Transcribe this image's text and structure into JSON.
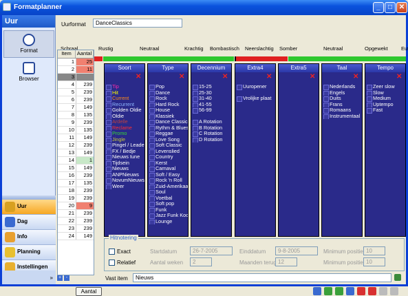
{
  "app": {
    "title": "Formatplanner"
  },
  "left": {
    "header": "Uur",
    "format": "Format",
    "browser": "Browser",
    "nav": [
      "Uur",
      "Dag",
      "Info",
      "Planning",
      "Instellingen"
    ]
  },
  "uurformat": {
    "label": "Uurformat",
    "value": "DanceClassics"
  },
  "scale": [
    "Schraal",
    "Rustig",
    "Neutraal",
    "Krachtig",
    "Bombastisch",
    "Neerslachtig",
    "Somber",
    "Neutraal",
    "Opgewekt",
    "Euforisch"
  ],
  "table": {
    "headers": [
      "Item",
      "Aantal"
    ],
    "rows": [
      [
        "1",
        "25"
      ],
      [
        "2",
        "11"
      ],
      [
        "3",
        ""
      ],
      [
        "4",
        "239"
      ],
      [
        "5",
        "239"
      ],
      [
        "6",
        "239"
      ],
      [
        "7",
        "149"
      ],
      [
        "8",
        "135"
      ],
      [
        "9",
        "239"
      ],
      [
        "10",
        "135"
      ],
      [
        "11",
        "149"
      ],
      [
        "12",
        "239"
      ],
      [
        "13",
        "149"
      ],
      [
        "14",
        "1"
      ],
      [
        "15",
        "149"
      ],
      [
        "16",
        "239"
      ],
      [
        "17",
        "135"
      ],
      [
        "18",
        "239"
      ],
      [
        "19",
        "239"
      ],
      [
        "20",
        "9"
      ],
      [
        "21",
        "239"
      ],
      [
        "22",
        "239"
      ],
      [
        "23",
        "239"
      ],
      [
        "24",
        "149"
      ]
    ],
    "button": "Aantal",
    "plus": "+",
    "minus": "-"
  },
  "panels": [
    {
      "title": "Soort",
      "items": [
        "Tip",
        "Hit",
        "Current",
        "Recurrent",
        "Golden Oldie",
        "Oldie",
        "Ardelle",
        "Reclame",
        "Promo",
        "Jingle",
        "Pingel / Leader",
        "FX / Bedje",
        "Nieuws tune",
        "Tijdsein",
        "Nieuws",
        "ANPNieuws",
        "NovumNieuws",
        "Weer"
      ],
      "colors": [
        "#ff2aa8",
        "#ffff00",
        "#ff8a1a",
        "#8fb7ff",
        "#ffffff",
        "#ffffff",
        "#c04040",
        "#ff3030",
        "#36d836",
        "#c8c83a",
        "#ffffff",
        "#ffffff",
        "#ffffff",
        "#ffffff",
        "#ffffff",
        "#ffffff",
        "#ffffff",
        "#ffffff"
      ]
    },
    {
      "title": "Type",
      "items": [
        "Pop",
        "Dance",
        "Rock",
        "Hard Rock",
        "House",
        "Klassiek",
        "Dance Classic",
        "Rythm & Blues",
        "Reggae",
        "Love Song",
        "Soft Classic",
        "Levenslied",
        "Country",
        "Kerst",
        "Carnaval",
        "Soft / Easy",
        "Rock 'n Roll",
        "Zuid-Amerikaans",
        "Soul",
        "Voetbal",
        "Soft pop",
        "Funk",
        "Jazz Funk Koor",
        "Lounge"
      ]
    },
    {
      "title": "Decennium",
      "items": [
        "15-25",
        "25-30",
        "31-40",
        "41-55",
        "56-99",
        "",
        "A Rotation",
        "B Rotation",
        "C Rotation",
        "D Rotation"
      ]
    },
    {
      "title": "Extra4",
      "items": [
        "Uuropener",
        "",
        "Vrolijke plaat"
      ]
    },
    {
      "title": "Extra5",
      "items": []
    },
    {
      "title": "Taal",
      "items": [
        "Nederlands",
        "Engels",
        "Duits",
        "Frans",
        "Romaans",
        "Instrumentaal"
      ]
    },
    {
      "title": "Tempo",
      "items": [
        "Zeer slow",
        "Slow",
        "Medium",
        "Uptempo",
        "Fast"
      ]
    }
  ],
  "hitnotering": {
    "title": "Hitnotering",
    "exact": "Exact",
    "relatief": "Relatief",
    "startdatum": "Startdatum",
    "startval": "26-7-2005",
    "aantalweken": "Aantal weken",
    "aantalval": "2",
    "einddatum": "Einddatum",
    "eindval": "9-8-2005",
    "maanden": "Maanden terug",
    "maandenval": "12",
    "minpos1": "Minimum positie",
    "minval1": "10",
    "minpos2": "Minimum positie",
    "minval2": "10"
  },
  "vastitem": {
    "label": "Vast item",
    "value": "Nieuws"
  },
  "colors": {
    "accent": "#0a52dd",
    "panel": "#2a2a8a",
    "highlight": "#f08070"
  }
}
